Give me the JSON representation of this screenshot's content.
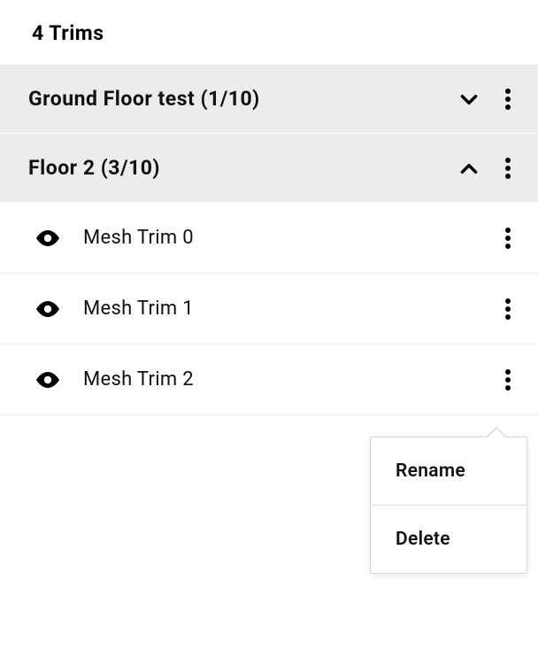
{
  "header": "4 Trims",
  "groups": [
    {
      "label": "Ground Floor test (1/10)",
      "expanded": false
    },
    {
      "label": "Floor 2 (3/10)",
      "expanded": true
    }
  ],
  "items": [
    {
      "label": "Mesh Trim 0"
    },
    {
      "label": "Mesh Trim 1"
    },
    {
      "label": "Mesh Trim 2"
    }
  ],
  "popover": {
    "rename": "Rename",
    "delete": "Delete"
  }
}
